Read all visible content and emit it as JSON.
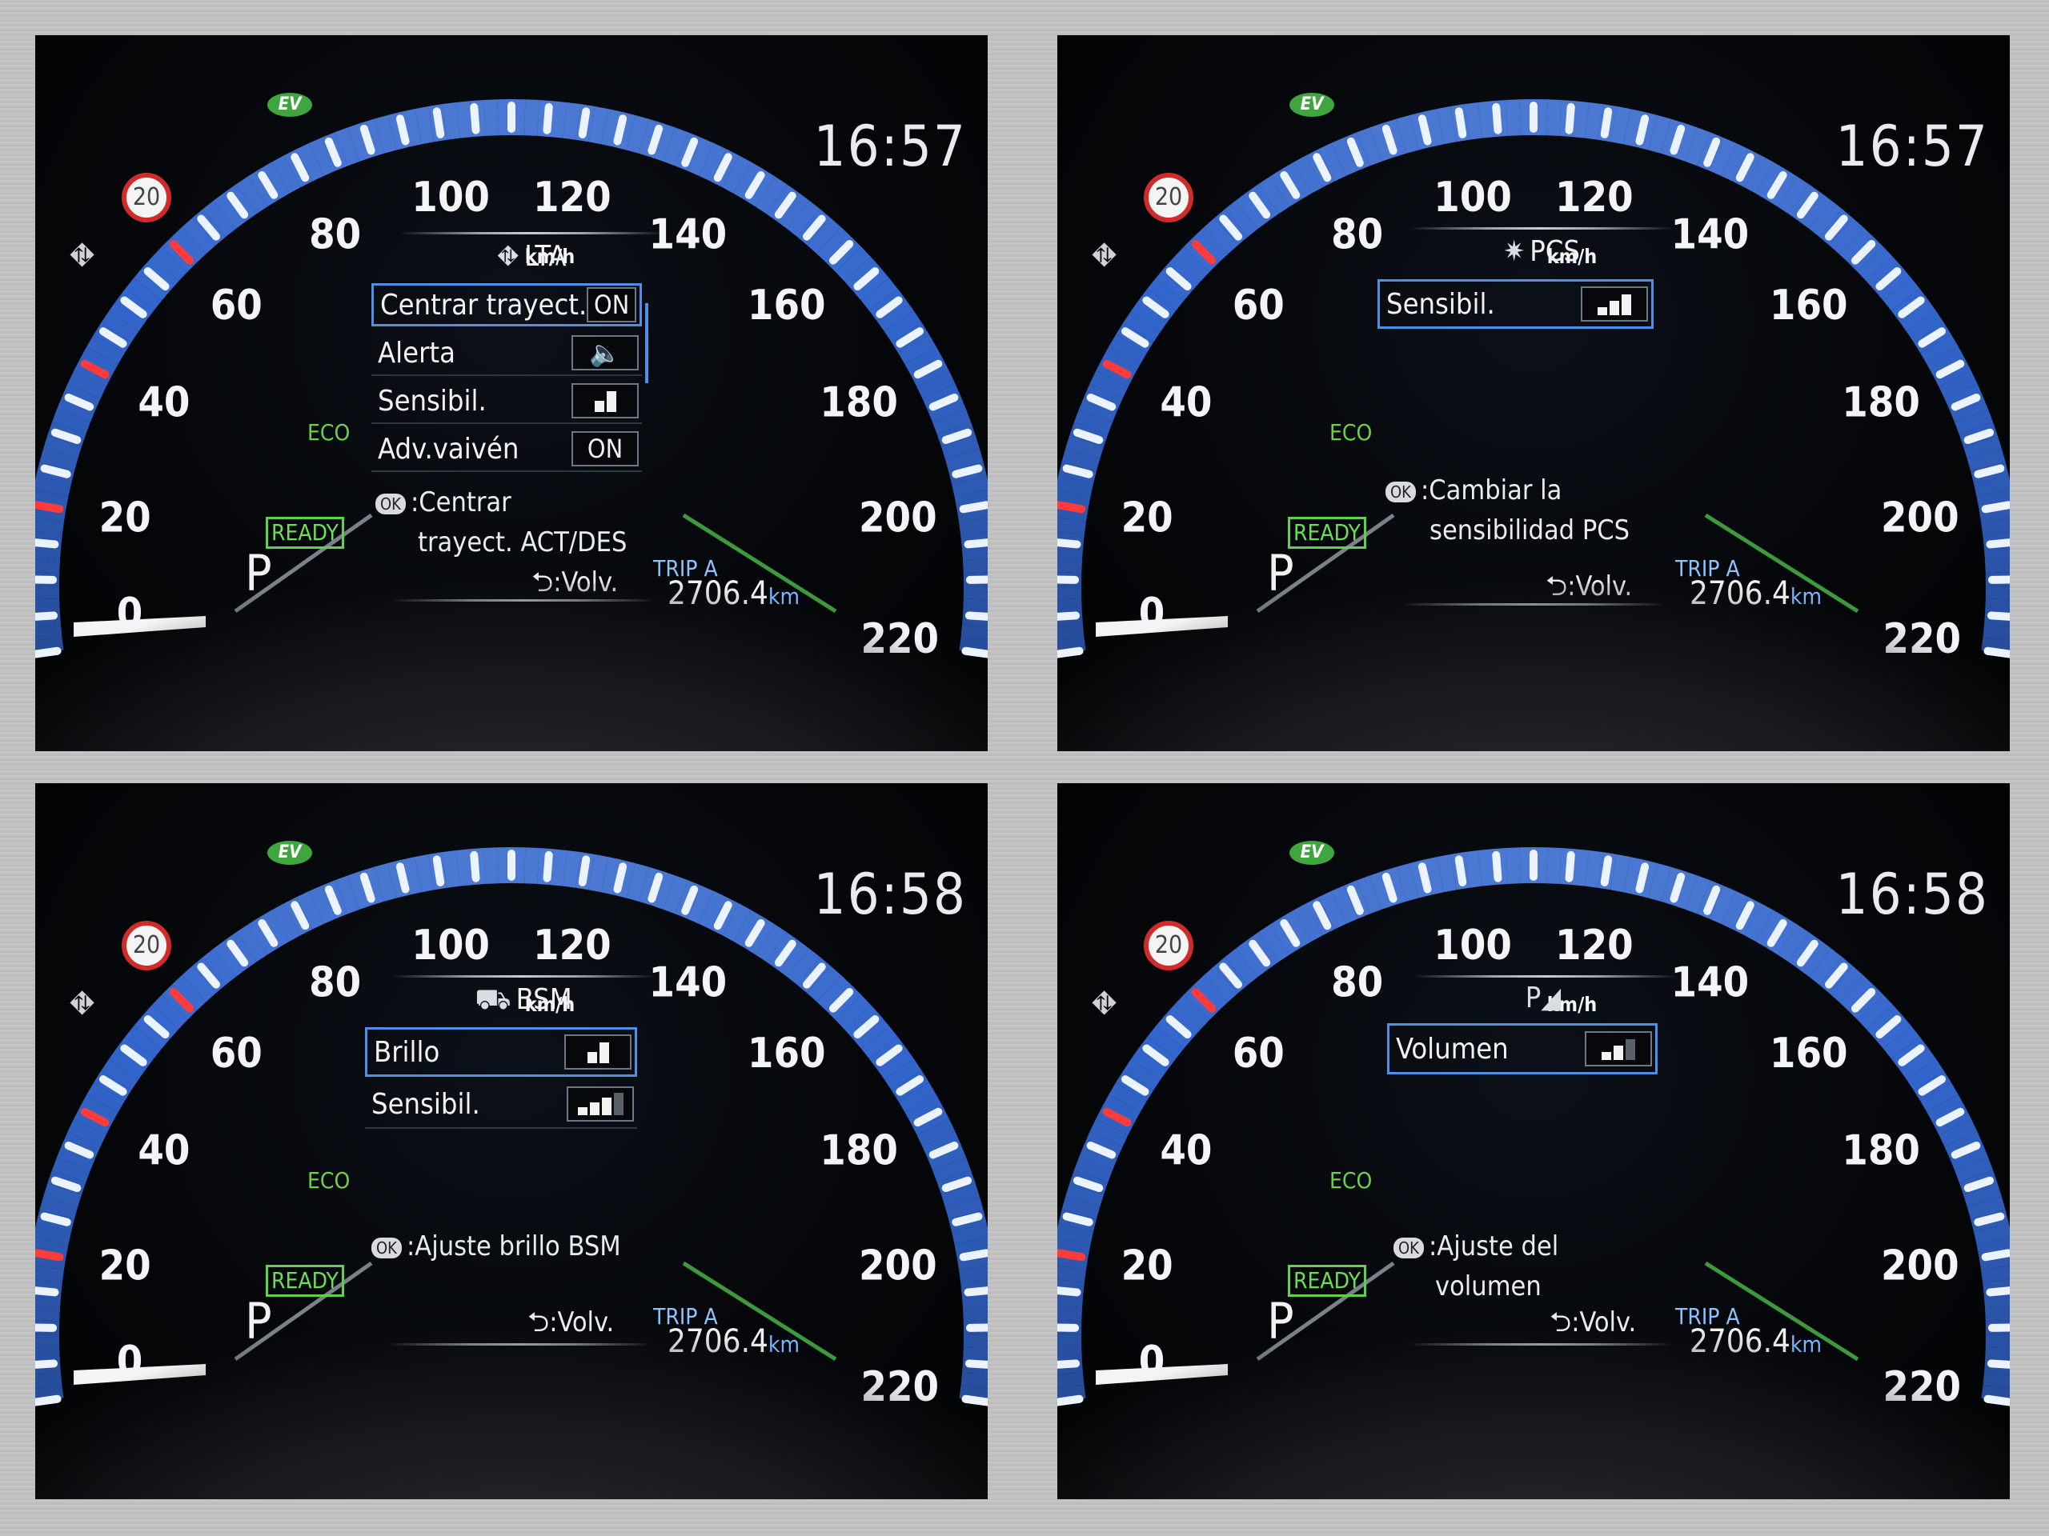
{
  "speedometer": {
    "unit": "km/h",
    "labels": [
      "20",
      "40",
      "60",
      "80",
      "100",
      "120",
      "140",
      "160",
      "180",
      "200",
      "220"
    ],
    "zero_label": "0"
  },
  "common": {
    "speed_limit": "20",
    "ev": "EV",
    "eco": "ECO",
    "ready": "READY",
    "gear": "P",
    "trip_label": "TRIP A",
    "odometer": "2706.4",
    "odometer_unit": "km",
    "back_label": ":Volv.",
    "ok_badge": "OK"
  },
  "panels": [
    {
      "clock": "16:57",
      "menu_title": "LTA",
      "menu_icon": "lane-trace-icon",
      "rows": [
        {
          "label": "Centrar trayect.",
          "value": "ON",
          "selected": true
        },
        {
          "label": "Alerta",
          "value": "speaker-icon",
          "selected": false
        },
        {
          "label": "Sensibil.",
          "value": "bars-2-of-2",
          "selected": false
        },
        {
          "label": "Adv.vaivén",
          "value": "ON",
          "selected": false
        }
      ],
      "hint": [
        ":Centrar",
        "trayect. ACT/DES"
      ]
    },
    {
      "clock": "16:57",
      "menu_title": "PCS",
      "menu_icon": "pre-collision-icon",
      "rows": [
        {
          "label": "Sensibil.",
          "value": "bars-2-of-3",
          "selected": true
        }
      ],
      "hint": [
        ":Cambiar la",
        "sensibilidad PCS"
      ]
    },
    {
      "clock": "16:58",
      "menu_title": "BSM",
      "menu_icon": "blind-spot-icon",
      "rows": [
        {
          "label": "Brillo",
          "value": "bars-2-of-2",
          "selected": true
        },
        {
          "label": "Sensibil.",
          "value": "bars-3-of-4",
          "selected": false
        }
      ],
      "hint": [
        ":Ajuste brillo BSM"
      ]
    },
    {
      "clock": "16:58",
      "menu_title": "",
      "menu_icon": "parking-sensor-icon",
      "rows": [
        {
          "label": "Volumen",
          "value": "bars-2-of-3",
          "selected": true
        }
      ],
      "hint": [
        ":Ajuste del",
        "volumen"
      ]
    }
  ]
}
